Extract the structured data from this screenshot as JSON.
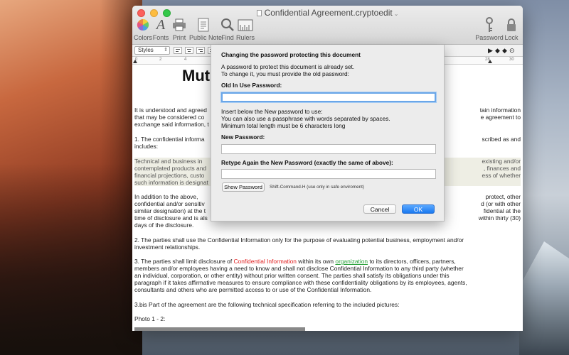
{
  "window": {
    "title": "Confidential Agreement.cryptoedit"
  },
  "toolbar": {
    "left": [
      {
        "label": "Colors",
        "icon": "color-wheel-icon"
      },
      {
        "label": "Fonts",
        "icon": "font-icon"
      },
      {
        "label": "Print",
        "icon": "printer-icon"
      },
      {
        "label": "Public Note",
        "icon": "note-icon"
      },
      {
        "label": "Find",
        "icon": "magnifier-icon"
      },
      {
        "label": "Rulers",
        "icon": "ruler-icon"
      }
    ],
    "right": [
      {
        "label": "Password",
        "icon": "key-icon"
      },
      {
        "label": "Lock",
        "icon": "lock-icon"
      }
    ]
  },
  "formatbar": {
    "styles_label": "Styles",
    "controls": [
      "▶",
      "◆",
      "◆",
      "⊙"
    ]
  },
  "ruler": {
    "numbers": [
      "0",
      "2",
      "4",
      "28",
      "30"
    ]
  },
  "document": {
    "title": "Mut",
    "paragraphs": [
      "It is understood and agreed",
      "that may be considered co",
      "exchange said information, t",
      "1. The confidential informa",
      "includes:",
      "Technical and business in",
      "contemplated products and",
      "financial projections, custo",
      "such information is designat",
      "In addition to the above, ",
      "confidential and/or sensitiv",
      "similar designation) at the t",
      "time of disclosure and is als",
      "days of the disclosure.",
      "2. The parties shall use the Confidential Information only for the purpose of evaluating potential business, employment and/or",
      "investment relationships.",
      "members and/or employees having a need to know and shall not disclose Confidential Information to any third party (whether",
      "an individual, corporation, or other entity) without prior written consent. The parties shall satisfy its obligations under this",
      "paragraph if it takes affirmative measures to ensure compliance with these confidentiality obligations by its employees, agents,",
      "consultants and others who are permitted access to or use of the Confidential Information.",
      "3.bis  Part of the agreement are the following technical specification referring to the included pictures:",
      "Photo 1 - 2:"
    ],
    "right_fragments": [
      "tain information",
      "e agreement to",
      "scribed as and",
      "existing and/or",
      ", finances and",
      "ess of whether",
      " protect, other",
      "d (or with other",
      "fidential at the",
      "within thirty (30)"
    ],
    "para3": {
      "start": "3. The parties shall limit disclosure of ",
      "red": "Confidential Information",
      "mid": " within its own ",
      "green": "organization",
      "end": " to its directors, officers, partners,"
    }
  },
  "dialog": {
    "heading": "Changing the password protecting this document",
    "intro1": "A password to protect this document is already set.",
    "intro2": "To change it, you must provide the old password:",
    "old_label": "Old In Use Password:",
    "old_value": "",
    "info1": "Insert below the New password to use:",
    "info2": "You can also use a passphrase with words separated by spaces.",
    "info3": "Minimum total length must be 6 characters long",
    "new_label": "New Password:",
    "new_value": "",
    "retype_label": "Retype Again the New Password (exactly the same of above):",
    "retype_value": "",
    "show_password": "Show Password",
    "shortcut_hint": "Shift-Command-H (use only in safe enviroment)",
    "cancel": "Cancel",
    "ok": "OK"
  }
}
